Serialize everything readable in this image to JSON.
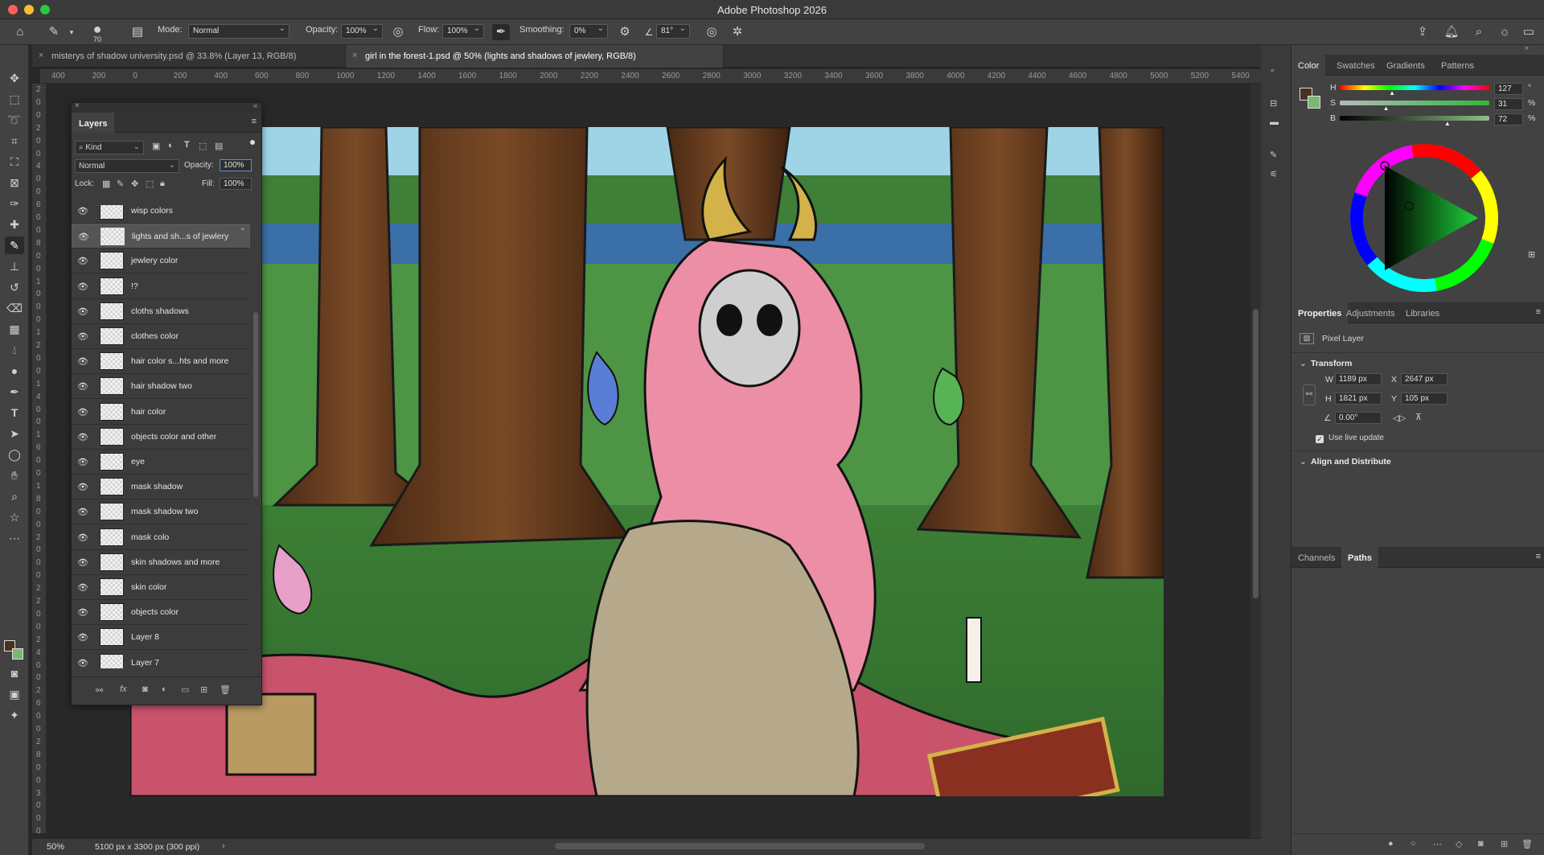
{
  "app": {
    "title": "Adobe Photoshop 2026"
  },
  "options_bar": {
    "brush_size": "70",
    "mode_label": "Mode:",
    "mode_value": "Normal",
    "opacity_label": "Opacity:",
    "opacity_value": "100%",
    "flow_label": "Flow:",
    "flow_value": "100%",
    "smoothing_label": "Smoothing:",
    "smoothing_value": "0%",
    "angle_value": "81°"
  },
  "doc_tabs": [
    {
      "label": "misterys of shadow university.psd @ 33.8% (Layer 13, RGB/8)"
    },
    {
      "label": "girl in the forest-1.psd @ 50% (lights and shadows of jewlery, RGB/8)"
    }
  ],
  "ruler": {
    "top": [
      "400",
      "200",
      "0",
      "200",
      "400",
      "600",
      "800",
      "1000",
      "1200",
      "1400",
      "1600",
      "1800",
      "2000",
      "2200",
      "2400",
      "2600",
      "2800",
      "3000",
      "3200",
      "3400",
      "3600",
      "3800",
      "4000",
      "4200",
      "4400",
      "4600",
      "4800",
      "5000",
      "5200",
      "5400"
    ],
    "left": [
      "2",
      "0",
      "0",
      "2",
      "0",
      "0",
      "4",
      "0",
      "0",
      "6",
      "0",
      "0",
      "8",
      "0",
      "0",
      "1",
      "0",
      "0",
      "0",
      "1",
      "2",
      "0",
      "0",
      "1",
      "4",
      "0",
      "0",
      "1",
      "6",
      "0",
      "0",
      "1",
      "8",
      "0",
      "0",
      "2",
      "0",
      "0",
      "0",
      "2",
      "2",
      "0",
      "0",
      "2",
      "4",
      "0",
      "0",
      "2",
      "6",
      "0",
      "0",
      "2",
      "8",
      "0",
      "0",
      "3",
      "0",
      "0",
      "0"
    ]
  },
  "layers_panel": {
    "title": "Layers",
    "filter_kind": "Kind",
    "blend_mode": "Normal",
    "opacity_label": "Opacity:",
    "opacity_value": "100%",
    "lock_label": "Lock:",
    "fill_label": "Fill:",
    "fill_value": "100%",
    "layers": [
      {
        "name": "wisp colors"
      },
      {
        "name": "lights and sh...s of jewlery"
      },
      {
        "name": "jewlery color"
      },
      {
        "name": "!?"
      },
      {
        "name": "cloths shadows"
      },
      {
        "name": "clothes color"
      },
      {
        "name": "hair color s...hts and more"
      },
      {
        "name": "hair shadow two"
      },
      {
        "name": "hair color"
      },
      {
        "name": "objects color and other"
      },
      {
        "name": "eye"
      },
      {
        "name": "mask shadow"
      },
      {
        "name": "mask shadow two"
      },
      {
        "name": "mask colo"
      },
      {
        "name": "skin shadows and more"
      },
      {
        "name": "skin color"
      },
      {
        "name": "objects color"
      },
      {
        "name": "Layer 8"
      },
      {
        "name": "Layer 7"
      }
    ],
    "selected_index": 1
  },
  "color_panel": {
    "tabs": [
      "Color",
      "Swatches",
      "Gradients",
      "Patterns"
    ],
    "h_label": "H",
    "h_value": "127",
    "h_unit": "°",
    "s_label": "S",
    "s_value": "31",
    "s_unit": "%",
    "b_label": "B",
    "b_value": "72",
    "b_unit": "%",
    "foreground": "#4a3020",
    "background": "#79b872",
    "h_fraction": 0.35,
    "s_fraction": 0.31,
    "b_fraction": 0.72
  },
  "properties_panel": {
    "tabs": [
      "Properties",
      "Adjustments",
      "Libraries"
    ],
    "layer_type": "Pixel Layer",
    "transform_label": "Transform",
    "w_label": "W",
    "w_value": "1189 px",
    "h_label": "H",
    "h_value": "1821 px",
    "x_label": "X",
    "x_value": "2647 px",
    "y_label": "Y",
    "y_value": "105 px",
    "angle_value": "0.00°",
    "live_update": "Use live update",
    "align_label": "Align and Distribute"
  },
  "paths_panel": {
    "tabs": [
      "Channels",
      "Paths"
    ]
  },
  "status": {
    "zoom": "50%",
    "doc_size": "5100 px x 3300 px (300 ppi)"
  }
}
